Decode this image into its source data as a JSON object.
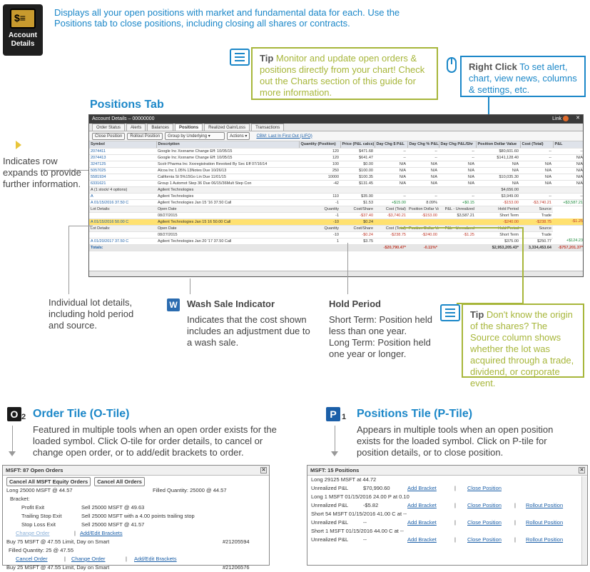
{
  "account_icon": {
    "label_line1": "Account",
    "label_line2": "Details",
    "icon": "account-details-icon"
  },
  "intro": "Displays all your open positions with market and fundamental data for each. Use the Positions tab to close positions, including closing all shares or contracts.",
  "tip1": {
    "head": "Tip",
    "text": "Monitor and update open orders & positions directly from your chart! Check out the Charts section of this guide for more information."
  },
  "right_click": {
    "head": "Right Click",
    "text": "To set alert, chart, view news, columns & settings, etc."
  },
  "positions_tab_title": "Positions Tab",
  "row_expand_note": "Indicates row expands to provide further information.",
  "lot_details_note": "Individual lot details, including hold period and source.",
  "wash_sale": {
    "title": "Wash Sale Indicator",
    "text": "Indicates that the cost shown includes an adjustment due to a wash sale."
  },
  "hold_period": {
    "title": "Hold Period",
    "short": "Short Term: Position held less than one year.",
    "long": "Long Term: Position held one year or longer."
  },
  "tip2": {
    "head": "Tip",
    "text": "Don't know the origin of the shares? The Source column shows whether the lot was acquired through a trade, dividend, or corporate event."
  },
  "window": {
    "title": "Account Details – 00000000",
    "link_label": "Link",
    "tabs": [
      "Order Status",
      "Alerts",
      "Balances",
      "Positions",
      "Realized Gain/Loss",
      "Transactions"
    ],
    "active_tab": "Positions",
    "buttons": [
      "Close Position",
      "Rollout Position"
    ],
    "group_by": "Group by Underlying",
    "actions": "Actions",
    "cost_basis_link": "CBM: Last In First Out (LIFO)",
    "columns": [
      "Symbol",
      "Description",
      "Quantity (Position)",
      "Price (P&L calcs)",
      "Day Chg $ P&L",
      "Day Chg % P&L",
      "Day Chg P&L/Shr",
      "Position Dollar Value",
      "Cost (Total)",
      "P&L"
    ],
    "rows": [
      [
        "2074411",
        "Google Inc      Xxxname Change      Eff: 10/05/15",
        "120",
        "$471.68",
        "--",
        "--",
        "--",
        "$80,601.60",
        "--",
        "--"
      ],
      [
        "2074413",
        "Google Inc      Xxxname Change      Eff: 10/05/15",
        "120",
        "$641.47",
        "--",
        "--",
        "--",
        "$141,128.40",
        "--",
        "N/A"
      ],
      [
        "3247125",
        "Scolr Pharma Inc   Xxxregistration Revoked By Sec Eff 07/16/14",
        "100",
        "$0.00",
        "N/A",
        "N/A",
        "N/A",
        "N/A",
        "N/A",
        "N/A"
      ],
      [
        "5057025",
        "Alcoa Inc      1.05% 13Notes      Due 10/26/13",
        "250",
        "$100.00",
        "N/A",
        "N/A",
        "N/A",
        "N/A",
        "N/A",
        "N/A"
      ],
      [
        "5581934",
        "California St      5%15Go Lin      Due 11/01/15",
        "10000",
        "$100.35",
        "N/A",
        "N/A",
        "N/A",
        "$10,035.30",
        "N/A",
        "N/A"
      ],
      [
        "6331621",
        "Group 1 Automot Step 36      Due 06/15/36Mult Step Con",
        "-42",
        "$131.45",
        "N/A",
        "N/A",
        "N/A",
        "N/A",
        "N/A",
        "N/A"
      ],
      [
        "A (1 stock/ 4 options)",
        "Agilent Technologies",
        "",
        "",
        "",
        "",
        "",
        "$4,656.00",
        "",
        ""
      ],
      [
        "A",
        "Agilent Technologies",
        "110",
        "$35.90",
        "--",
        "--",
        "--",
        "$3,949.00",
        "--",
        "--"
      ],
      [
        "A 01/15/2016 37.50 C",
        "Agilent Technologies Jan 15 '16 37.50 Call",
        "-1",
        "$1.53",
        "+$15.00",
        "8.09%",
        "+$0.15",
        "-$153.00",
        "-$3,740.21",
        "+$3,587.21"
      ]
    ],
    "lot_header": [
      "Lot Details:",
      "Open Date",
      "Quantity",
      "Cost/Share",
      "Cost (Total)",
      "Position Dollar Value",
      "P&L - Unrealized",
      "Hold Period",
      "Source"
    ],
    "lot_row1": [
      "",
      "08/27/2015",
      "-1",
      "-$37.40",
      "-$3,740.21",
      "-$153.00",
      "$3,587.21",
      "Short Term",
      "Trade"
    ],
    "highlight_row": [
      "A 01/15/2016 50.00 C",
      "Agilent Technologies Jan 15 16 50.00 Call",
      "-10",
      "$0.24",
      "",
      "",
      "",
      "-$240.00",
      "-$238.75",
      "-$1.25"
    ],
    "lot_row2": [
      "",
      "08/27/2015",
      "-10",
      "-$0.24",
      "-$238.75",
      "-$240.00",
      "-$1.25",
      "Short Term",
      "Trade"
    ],
    "row_last": [
      "A 01/20/2017 37.50 C",
      "Agilent Technologies Jan 20 '17 37.50 Call",
      "1",
      "$3.75",
      "",
      "",
      "",
      "$375.00",
      "$250.77",
      "+$124.23"
    ],
    "totals": [
      "Totals:",
      "",
      "",
      "",
      "-$20,790.47*",
      "-0.11%*",
      "",
      "$2,953,205.43*",
      "3,334,453.64",
      "-$757,201.37*"
    ]
  },
  "order_tile": {
    "badge": "O",
    "badge_num": "2",
    "title": "Order Tile (O-Tile)",
    "text": "Featured in multiple tools when an open order exists for the loaded symbol. Click O-tile for order details, to cancel or change open order, or to add/edit brackets to order.",
    "header": "MSFT: 87 Open Orders",
    "btn_cancel_equity": "Cancel All MSFT Equity Orders",
    "btn_cancel_all": "Cancel All Orders",
    "line1": "Long 25000 MSFT @ 44.57",
    "line1_filled": "Filled Quantity: 25000 @ 44.57",
    "bracket": "Bracket:",
    "profit_exit_label": "Profit Exit",
    "profit_exit": "Sell 25000 MSFT @ 49.63",
    "trailing_label": "Trailing Stop Exit",
    "trailing": "Sell 25000 MSFT with a 4.00 points trailing stop",
    "stoploss_label": "Stop Loss Exit",
    "stoploss": "Sell 25000 MSFT @ 41.57",
    "change_order": "Change Order",
    "add_edit_brackets": "Add/Edit Brackets",
    "buy1": "Buy 75 MSFT @ 47.55 Limit, Day on Smart",
    "buy1_id": "#21205594",
    "buy1_filled": "Filled Quantity: 25 @ 47.55",
    "cancel_order": "Cancel Order",
    "buy2": "Buy 25 MSFT @ 47.55 Limit, Day on Smart",
    "buy2_id": "#21206576"
  },
  "position_tile": {
    "badge": "P",
    "badge_num": "1",
    "title": "Positions Tile (P-Tile)",
    "text": "Appears in multiple tools when an open position exists for the loaded symbol. Click on P-tile for position details, or to close position.",
    "header": "MSFT: 15 Positions",
    "rows": [
      {
        "pos": "Long 29125 MSFT at 44.72",
        "pl_label": "Unrealized P&L",
        "pl": "$70,990.60",
        "add": "Add Bracket",
        "close": "Close Position",
        "rollout": ""
      },
      {
        "pos": "Long 1 MSFT 01/15/2016 24.00 P at 0.10",
        "pl_label": "Unrealized P&L",
        "pl": "-$5.82",
        "add": "Add Bracket",
        "close": "Close Position",
        "rollout": "Rollout Position"
      },
      {
        "pos": "Short 54 MSFT 01/15/2016 41.00 C at --",
        "pl_label": "Unrealized P&L",
        "pl": "--",
        "add": "Add Bracket",
        "close": "Close Position",
        "rollout": "Rollout Position"
      },
      {
        "pos": "Short 1 MSFT 01/15/2016 44.00 C at --",
        "pl_label": "Unrealized P&L",
        "pl": "--",
        "add": "Add Bracket",
        "close": "Close Position",
        "rollout": "Rollout Position"
      }
    ]
  }
}
